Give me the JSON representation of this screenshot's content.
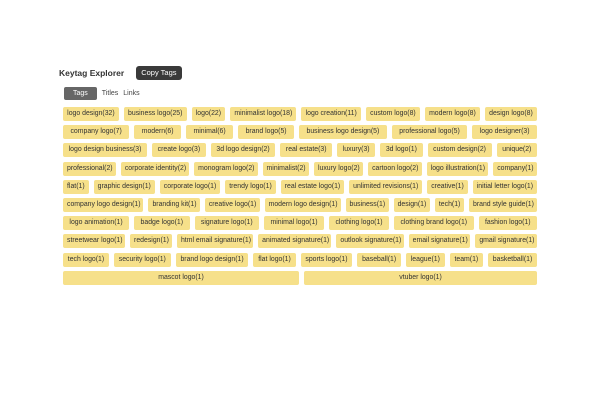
{
  "header": {
    "title": "Keytag Explorer",
    "copy_label": "Copy Tags"
  },
  "tabs": [
    "Tags",
    "Titles",
    "Links"
  ],
  "active_tab": "Tags",
  "tag_rows": [
    [
      "logo design(32)",
      "business logo(25)",
      "logo(22)",
      "minimalist logo(18)",
      "logo creation(11)",
      "custom logo(8)",
      "modern logo(8)",
      "design logo(8)"
    ],
    [
      "company logo(7)",
      "modern(6)",
      "minimal(6)",
      "brand logo(5)",
      "business logo design(5)",
      "professional logo(5)",
      "logo designer(3)"
    ],
    [
      "logo design business(3)",
      "create logo(3)",
      "3d logo design(2)",
      "real estate(3)",
      "luxury(3)",
      "3d logo(1)",
      "custom design(2)",
      "unique(2)"
    ],
    [
      "professional(2)",
      "corporate identity(2)",
      "monogram logo(2)",
      "minimalist(2)",
      "luxury logo(2)",
      "cartoon logo(2)",
      "logo illustration(1)",
      "company(1)"
    ],
    [
      "flat(1)",
      "graphic design(1)",
      "corporate logo(1)",
      "trendy logo(1)",
      "real estate logo(1)",
      "unlimited revisions(1)",
      "creative(1)",
      "initial letter logo(1)"
    ],
    [
      "company logo design(1)",
      "branding kit(1)",
      "creative logo(1)",
      "modern logo design(1)",
      "business(1)",
      "design(1)",
      "tech(1)",
      "brand style guide(1)"
    ],
    [
      "logo animation(1)",
      "badge logo(1)",
      "signature logo(1)",
      "minimal logo(1)",
      "clothing logo(1)",
      "clothing brand logo(1)",
      "fashion logo(1)"
    ],
    [
      "streetwear logo(1)",
      "redesign(1)",
      "html email signature(1)",
      "animated signature(1)",
      "outlook signature(1)",
      "email signature(1)",
      "gmail signature(1)"
    ],
    [
      "tech logo(1)",
      "security logo(1)",
      "brand logo design(1)",
      "flat logo(1)",
      "sports logo(1)",
      "baseball(1)",
      "league(1)",
      "team(1)",
      "basketball(1)"
    ],
    [
      "mascot logo(1)",
      "vtuber logo(1)"
    ]
  ]
}
